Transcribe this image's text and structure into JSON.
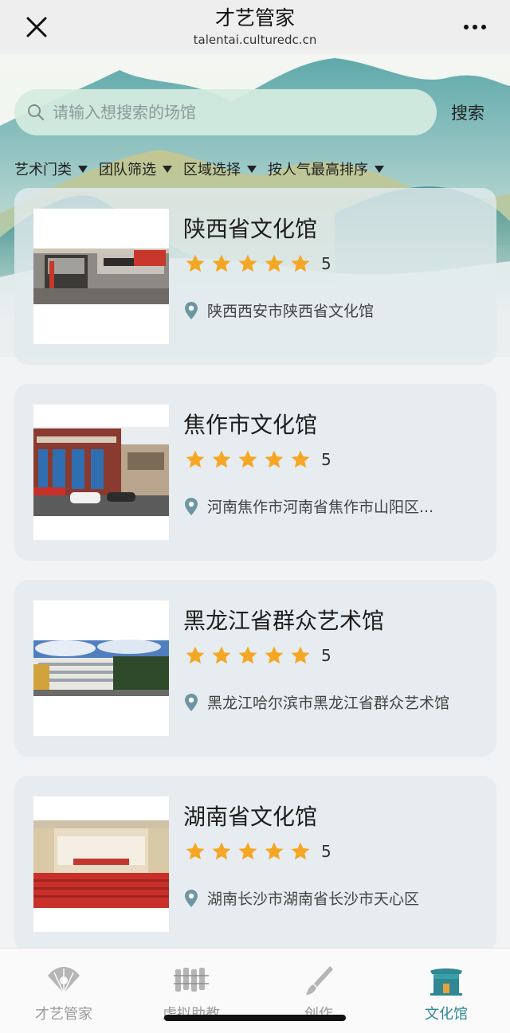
{
  "nav": {
    "title": "才艺管家",
    "url": "talentai.culturedc.cn",
    "close_icon": "close-icon",
    "more_icon": "more-dots-icon"
  },
  "search": {
    "placeholder": "请输入想搜索的场馆",
    "value": "",
    "button": "搜索"
  },
  "filters": [
    {
      "label": "艺术门类"
    },
    {
      "label": "团队筛选"
    },
    {
      "label": "区域选择"
    },
    {
      "label": "按人气最高排序"
    }
  ],
  "venues": [
    {
      "name": "陕西省文化馆",
      "rating": "5",
      "stars": 5,
      "address": "陕西西安市陕西省文化馆"
    },
    {
      "name": "焦作市文化馆",
      "rating": "5",
      "stars": 5,
      "address": "河南焦作市河南省焦作市山阳区..."
    },
    {
      "name": "黑龙江省群众艺术馆",
      "rating": "5",
      "stars": 5,
      "address": "黑龙江哈尔滨市黑龙江省群众艺术馆"
    },
    {
      "name": "湖南省文化馆",
      "rating": "5",
      "stars": 5,
      "address": "湖南长沙市湖南省长沙市天心区"
    }
  ],
  "tabs": [
    {
      "label": "才艺管家",
      "icon": "fan-icon",
      "active": false
    },
    {
      "label": "虚拟助教",
      "icon": "bamboo-slips-icon",
      "active": false
    },
    {
      "label": "创作",
      "icon": "brush-icon",
      "active": false
    },
    {
      "label": "文化馆",
      "icon": "museum-building-icon",
      "active": true
    }
  ],
  "colors": {
    "accent": "#2f8894",
    "star": "#f5a623",
    "pin": "#6c96a3"
  }
}
